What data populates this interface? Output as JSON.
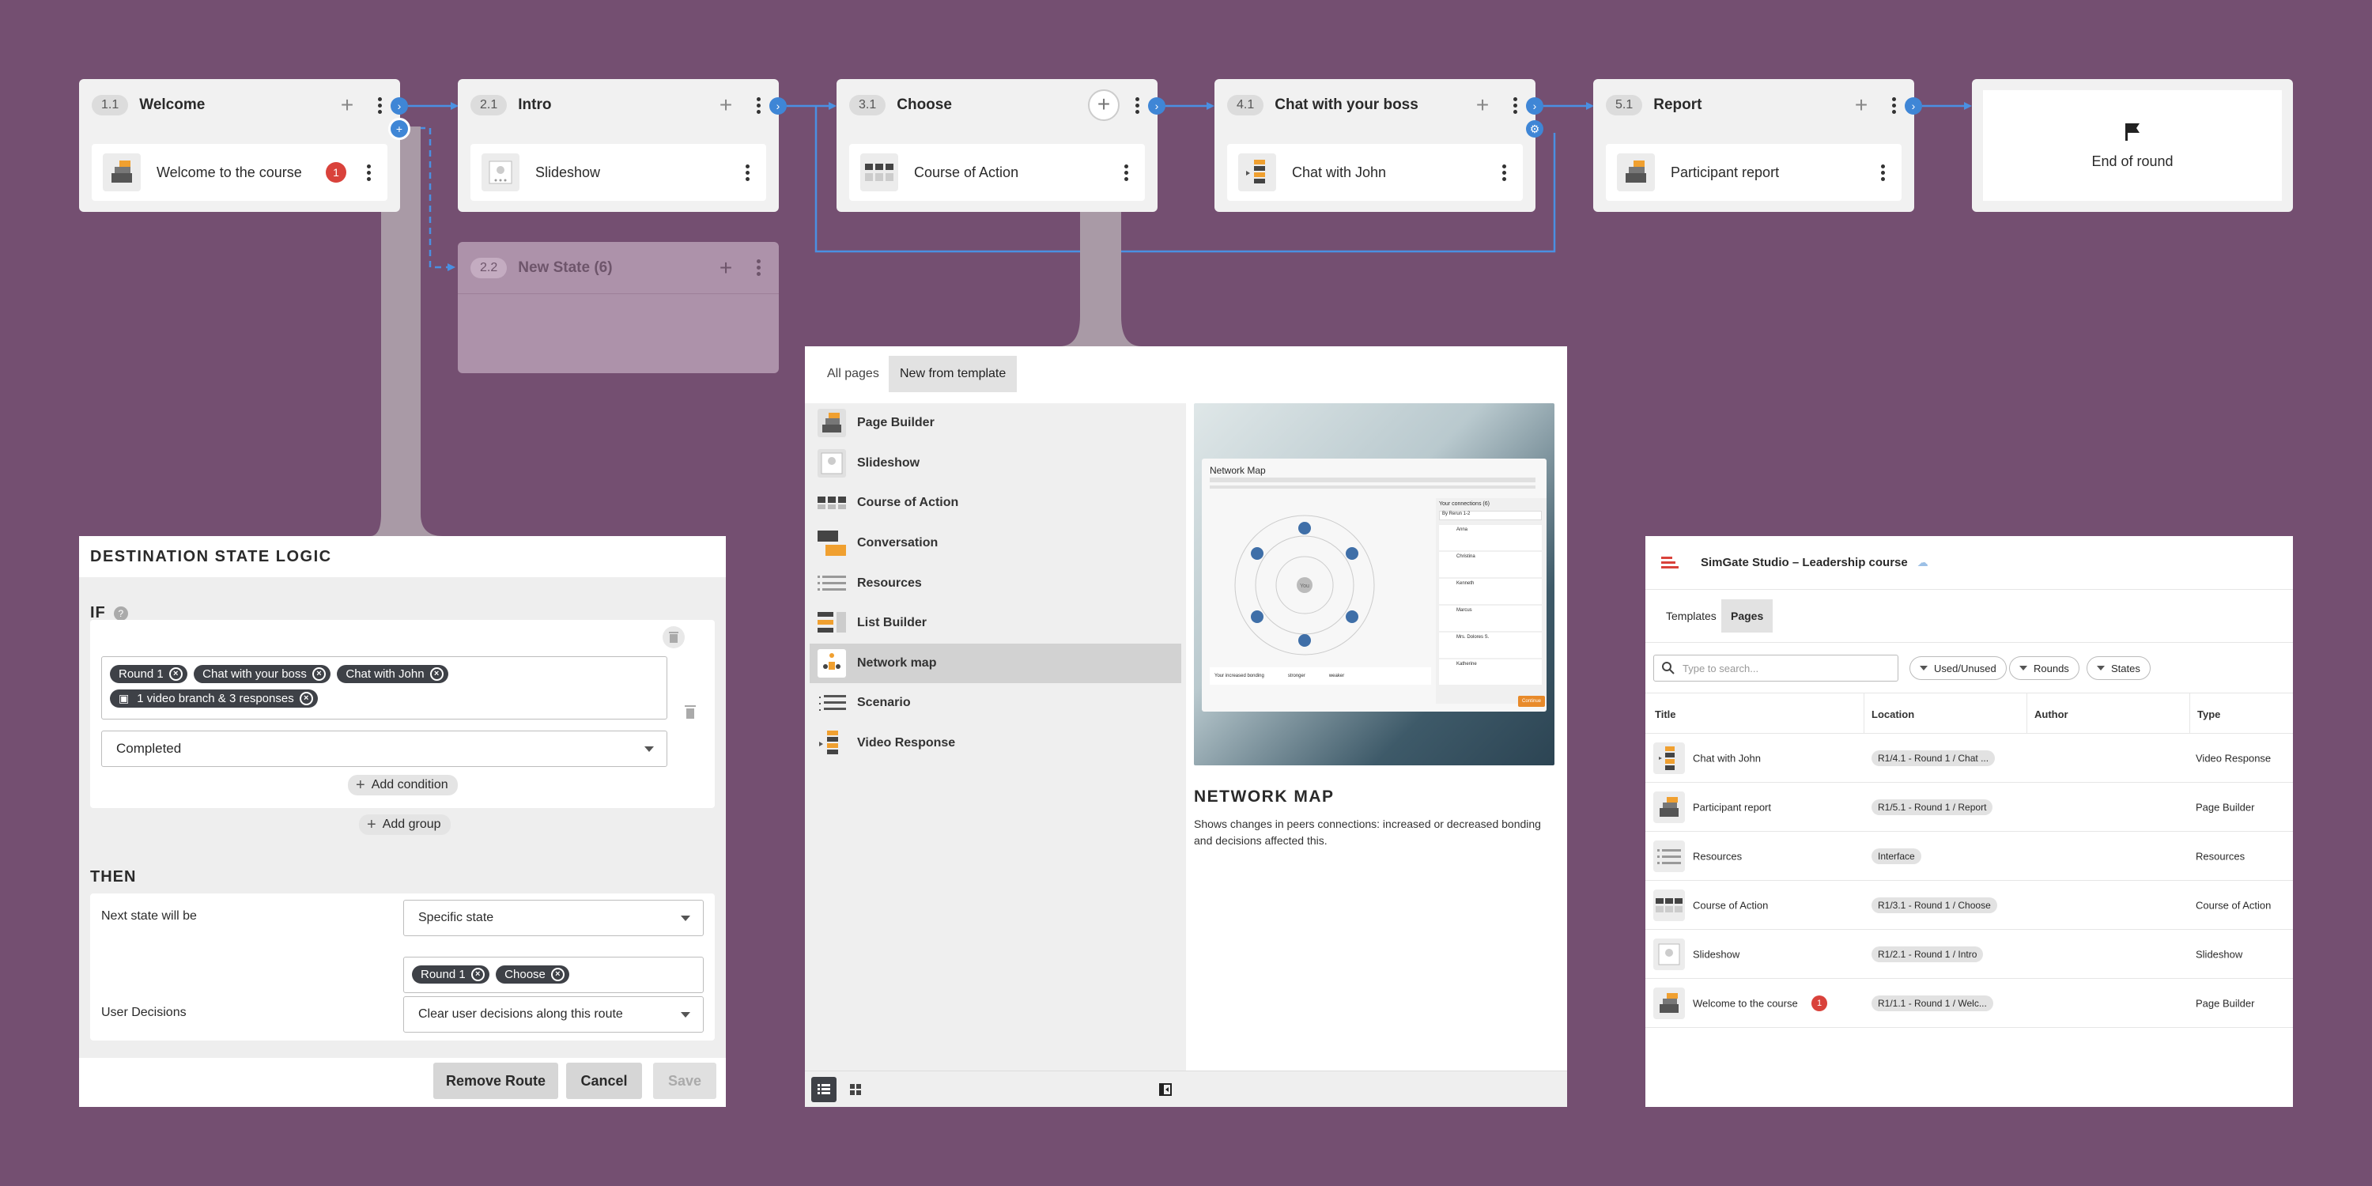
{
  "states": [
    {
      "num": "1.1",
      "title": "Welcome",
      "page": "Welcome to the course",
      "badge": "1"
    },
    {
      "num": "2.1",
      "title": "Intro",
      "page": "Slideshow"
    },
    {
      "num": "3.1",
      "title": "Choose",
      "page": "Course of Action"
    },
    {
      "num": "4.1",
      "title": "Chat with your boss",
      "page": "Chat with John"
    },
    {
      "num": "5.1",
      "title": "Report",
      "page": "Participant report"
    }
  ],
  "new_state": {
    "num": "2.2",
    "title": "New State (6)"
  },
  "end_card": {
    "label": "End of round",
    "icon": "flag-icon"
  },
  "destination_logic": {
    "heading": "DESTINATION STATE LOGIC",
    "if_label": "IF",
    "conditions": [
      "Round 1",
      "Chat with your boss",
      "Chat with John",
      "1 video branch & 3 responses"
    ],
    "status_select": "Completed",
    "add_condition": "Add condition",
    "add_group": "Add group",
    "then_label": "THEN",
    "next_state_label": "Next state will be",
    "next_state_select": "Specific state",
    "target_chips": [
      "Round 1",
      "Choose"
    ],
    "user_decisions_label": "User Decisions",
    "user_decisions_select": "Clear user decisions along this route",
    "remove_route": "Remove Route",
    "cancel": "Cancel",
    "save": "Save"
  },
  "template_picker": {
    "tabs": [
      "All pages",
      "New from template"
    ],
    "templates": [
      "Page Builder",
      "Slideshow",
      "Course of Action",
      "Conversation",
      "Resources",
      "List Builder",
      "Network map",
      "Scenario",
      "Video Response"
    ],
    "selected": "Network map",
    "preview": {
      "heading": "NETWORK MAP",
      "description": "Shows changes in peers connections: increased or decreased bonding and decisions affected this.",
      "inner_title": "Network Map",
      "inner_side_title": "Your connections (6)",
      "inner_dropdown": "By Rerun 1-2",
      "inner_names": [
        "Anna",
        "Christina",
        "Kenneth",
        "Marcus",
        "Mrs. Dolores S.",
        "Katherine"
      ],
      "inner_status": [
        "Person",
        "Person",
        "Person",
        "Person",
        "Person",
        "Person"
      ],
      "inner_center": "You",
      "inner_footer": [
        "Your increased bonding",
        "stronger",
        "weaker"
      ],
      "inner_continue": "Continue"
    }
  },
  "pages_panel": {
    "app_title": "SimGate Studio – Leadership course",
    "tabs": [
      "Templates",
      "Pages"
    ],
    "search_placeholder": "Type to search...",
    "filters": [
      "Used/Unused",
      "Rounds",
      "States"
    ],
    "columns": [
      "Title",
      "Location",
      "Author",
      "Type"
    ],
    "rows": [
      {
        "title": "Chat with John",
        "location": "R1/4.1 - Round 1 / Chat ...",
        "author": "",
        "type": "Video Response"
      },
      {
        "title": "Participant report",
        "location": "R1/5.1 - Round 1 / Report",
        "author": "",
        "type": "Page Builder"
      },
      {
        "title": "Resources",
        "location": "Interface",
        "author": "",
        "type": "Resources"
      },
      {
        "title": "Course of Action",
        "location": "R1/3.1 - Round 1 / Choose",
        "author": "",
        "type": "Course of Action"
      },
      {
        "title": "Slideshow",
        "location": "R1/2.1 - Round 1 / Intro",
        "author": "",
        "type": "Slideshow"
      },
      {
        "title": "Welcome to the course",
        "location": "R1/1.1 - Round 1 / Welc...",
        "author": "",
        "type": "Page Builder",
        "badge": "1"
      }
    ]
  },
  "colors": {
    "background": "#744f71",
    "connector": "#3f86d6",
    "badge": "#d9423b"
  }
}
